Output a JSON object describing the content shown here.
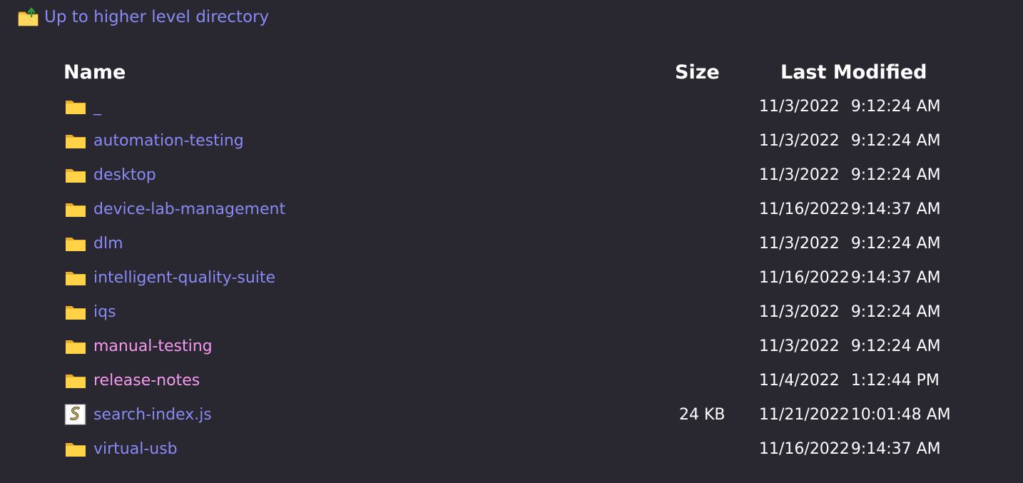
{
  "up_link": {
    "label": "Up to higher level directory",
    "icon": "folder-up-icon"
  },
  "headers": {
    "name": "Name",
    "size": "Size",
    "modified": "Last Modified"
  },
  "colors": {
    "link": "#8a8af5",
    "visited_link": "#f39af0",
    "background": "#29272f",
    "folder": "#f6c544"
  },
  "entries": [
    {
      "name": "_",
      "type": "folder",
      "size": "",
      "date": "11/3/2022",
      "time": "9:12:24 AM",
      "visited": false
    },
    {
      "name": "automation-testing",
      "type": "folder",
      "size": "",
      "date": "11/3/2022",
      "time": "9:12:24 AM",
      "visited": false
    },
    {
      "name": "desktop",
      "type": "folder",
      "size": "",
      "date": "11/3/2022",
      "time": "9:12:24 AM",
      "visited": false
    },
    {
      "name": "device-lab-management",
      "type": "folder",
      "size": "",
      "date": "11/16/2022",
      "time": "9:14:37 AM",
      "visited": false
    },
    {
      "name": "dlm",
      "type": "folder",
      "size": "",
      "date": "11/3/2022",
      "time": "9:12:24 AM",
      "visited": false
    },
    {
      "name": "intelligent-quality-suite",
      "type": "folder",
      "size": "",
      "date": "11/16/2022",
      "time": "9:14:37 AM",
      "visited": false
    },
    {
      "name": "iqs",
      "type": "folder",
      "size": "",
      "date": "11/3/2022",
      "time": "9:12:24 AM",
      "visited": false
    },
    {
      "name": "manual-testing",
      "type": "folder",
      "size": "",
      "date": "11/3/2022",
      "time": "9:12:24 AM",
      "visited": true
    },
    {
      "name": "release-notes",
      "type": "folder",
      "size": "",
      "date": "11/4/2022",
      "time": "1:12:44 PM",
      "visited": true
    },
    {
      "name": "search-index.js",
      "type": "script",
      "size": "24 KB",
      "date": "11/21/2022",
      "time": "10:01:48 AM",
      "visited": false
    },
    {
      "name": "virtual-usb",
      "type": "folder",
      "size": "",
      "date": "11/16/2022",
      "time": "9:14:37 AM",
      "visited": false
    }
  ]
}
